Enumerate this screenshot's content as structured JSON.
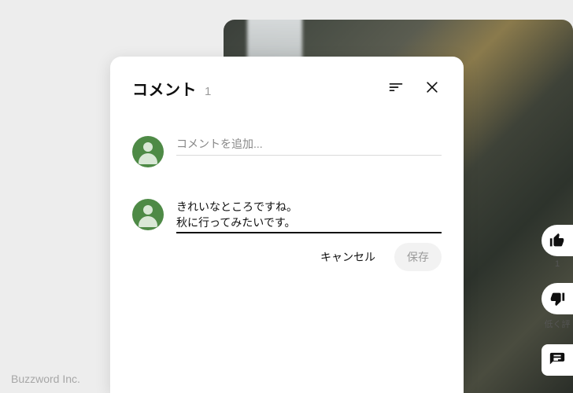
{
  "panel": {
    "title": "コメント",
    "count": "1",
    "add_placeholder": "コメントを追加...",
    "edit_text": "きれいなところですね。\n秋に行ってみたいです。",
    "cancel_label": "キャンセル",
    "save_label": "保存"
  },
  "rail": {
    "like_count": "1",
    "dislike_label": "低く評"
  },
  "footer": "Buzzword Inc."
}
